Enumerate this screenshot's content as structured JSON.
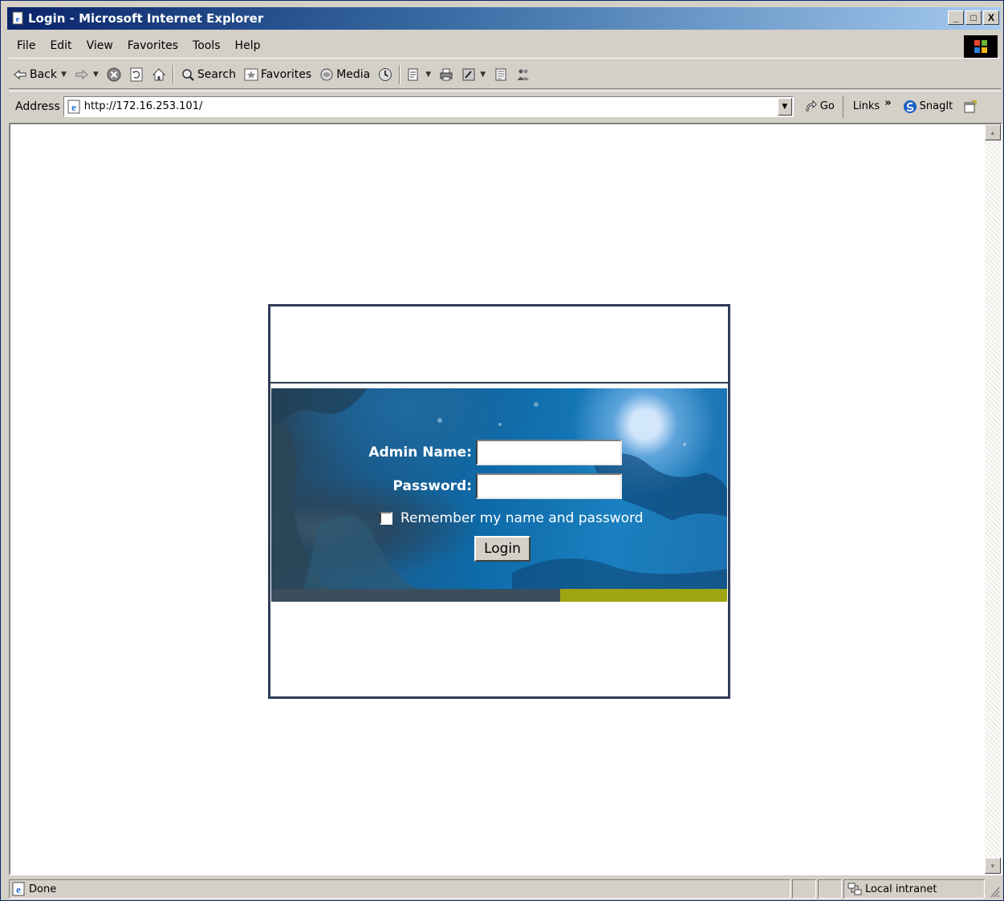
{
  "window": {
    "title": "Login - Microsoft Internet Explorer",
    "controls": {
      "minimize": "_",
      "maximize": "□",
      "close": "X"
    }
  },
  "menu": [
    "File",
    "Edit",
    "View",
    "Favorites",
    "Tools",
    "Help"
  ],
  "toolbar": {
    "back_label": "Back",
    "search_label": "Search",
    "favorites_label": "Favorites",
    "media_label": "Media"
  },
  "address": {
    "label": "Address",
    "url": "http://172.16.253.101/",
    "go_label": "Go",
    "links_label": "Links",
    "links_chevron": "»",
    "snagit_label": "SnagIt"
  },
  "login": {
    "admin_name_label": "Admin Name:",
    "admin_name_value": "",
    "password_label": "Password:",
    "password_value": "",
    "remember_label": "Remember my name and password",
    "remember_checked": false,
    "login_button": "Login"
  },
  "status": {
    "text": "Done",
    "zone": "Local intranet"
  },
  "colors": {
    "title_gradient_start": "#0a246a",
    "title_gradient_end": "#a6caf0",
    "panel_border": "#2e3d55",
    "stripe_left": "#3a4e5e",
    "stripe_right": "#9ea510",
    "banner_blue": "#0e6aa8"
  }
}
